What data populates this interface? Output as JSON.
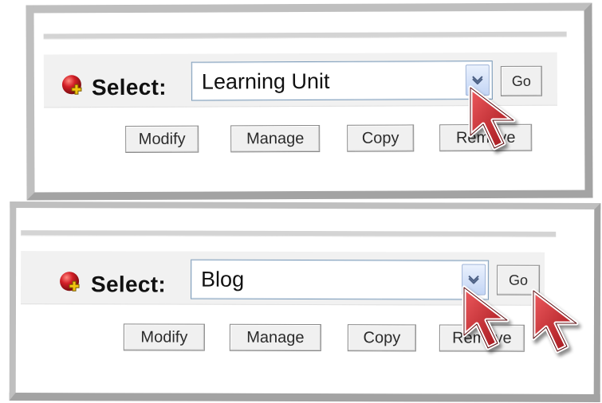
{
  "panels": [
    {
      "select_label": "Select:",
      "selected_type": "Learning Unit",
      "go_label": "Go",
      "actions": {
        "modify": "Modify",
        "manage": "Manage",
        "copy": "Copy",
        "remove": "Remove"
      }
    },
    {
      "select_label": "Select:",
      "selected_type": "Blog",
      "go_label": "Go",
      "actions": {
        "modify": "Modify",
        "manage": "Manage",
        "copy": "Copy",
        "remove": "Remove"
      }
    }
  ],
  "icons": {
    "add": "add-plus-icon",
    "dropdown": "chevron-down-icon",
    "cursor": "arrow-cursor-icon"
  },
  "colors": {
    "panel_border": "#bfbfbf",
    "select_border": "#7f9db9",
    "dropdown_fill": "#c3d5f5",
    "cursor_fill": "#c21c22",
    "add_icon_red": "#d31f27",
    "add_icon_plus": "#f1c40f"
  }
}
